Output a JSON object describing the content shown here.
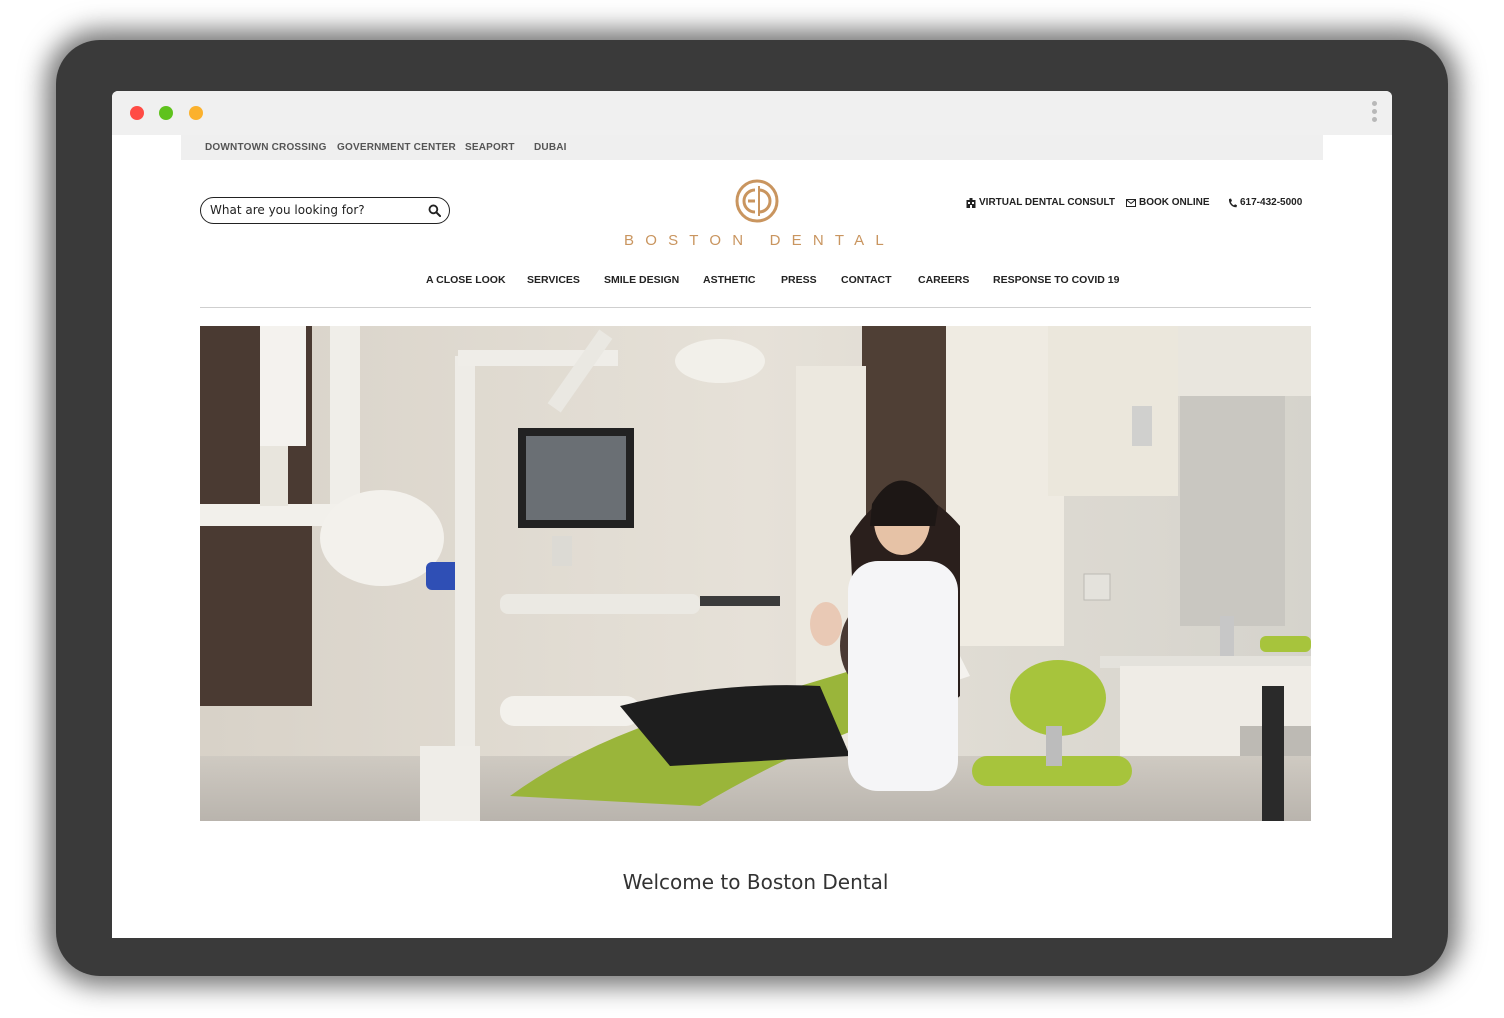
{
  "window": {
    "controls": [
      "close",
      "minimize",
      "maximize"
    ],
    "menu_icon": "kebab-vertical-icon"
  },
  "locations": [
    "DOWNTOWN CROSSING",
    "GOVERNMENT CENTER",
    "SEAPORT",
    "DUBAI"
  ],
  "search": {
    "placeholder": "What are you looking for?",
    "icon": "search-icon"
  },
  "brand": {
    "name": "BOSTON DENTAL",
    "accent_color": "#c9955f"
  },
  "utility_links": [
    {
      "label": "VIRTUAL DENTAL CONSULT",
      "icon": "hospital-icon"
    },
    {
      "label": "BOOK ONLINE",
      "icon": "envelope-icon"
    },
    {
      "label": "617-432-5000",
      "icon": "phone-icon"
    }
  ],
  "nav": [
    "A CLOSE LOOK",
    "SERVICES",
    "SMILE DESIGN",
    "ASTHETIC",
    "PRESS",
    "CONTACT",
    "CAREERS",
    "RESPONSE TO COVID 19"
  ],
  "hero": {
    "subject": "dentist-with-patient-photo"
  },
  "welcome": {
    "heading": "Welcome to Boston Dental"
  }
}
